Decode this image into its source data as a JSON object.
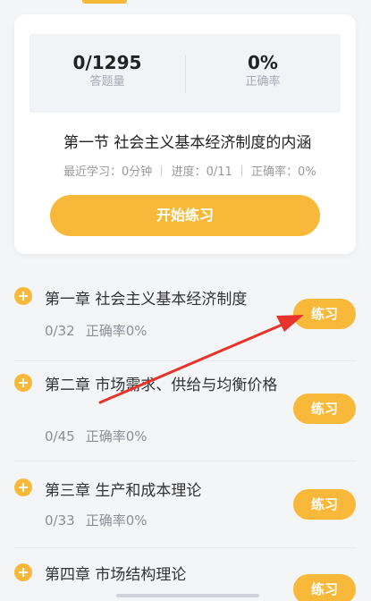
{
  "summary": {
    "answered": "0/1295",
    "answered_label": "答题量",
    "accuracy": "0%",
    "accuracy_label": "正确率"
  },
  "current_section": {
    "title": "第一节  社会主义基本经济制度的内涵",
    "recent_study": "最近学习：0分钟",
    "progress": "进度：0/11",
    "accuracy": "正确率：0%",
    "start_button": "开始练习"
  },
  "chapters": [
    {
      "title": "第一章  社会主义基本经济制度",
      "progress": "0/32",
      "accuracy": "正确率0%",
      "button": "练习"
    },
    {
      "title": "第二章  市场需求、供给与均衡价格",
      "progress": "0/45",
      "accuracy": "正确率0%",
      "button": "练习"
    },
    {
      "title": "第三章  生产和成本理论",
      "progress": "0/33",
      "accuracy": "正确率0%",
      "button": "练习"
    },
    {
      "title": "第四章  市场结构理论",
      "progress": "",
      "accuracy": "",
      "button": "练习"
    }
  ],
  "colors": {
    "accent": "#f8b93a",
    "annotation_arrow": "#e8322c"
  }
}
